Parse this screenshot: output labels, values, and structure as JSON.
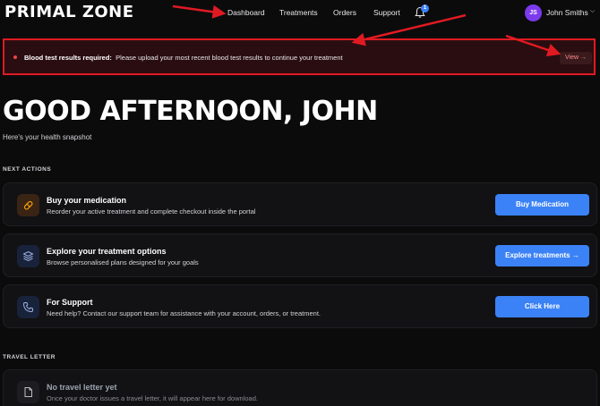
{
  "header": {
    "logo": "PRIMAL ZONE",
    "nav": [
      "Dashboard",
      "Treatments",
      "Orders",
      "Support"
    ],
    "notification_count": "1",
    "user_initials": "JS",
    "user_name": "John Smiths"
  },
  "alert": {
    "title": "Blood test results required:",
    "message": "Please upload your most recent blood test results to continue your treatment",
    "action_label": "View →"
  },
  "greeting": {
    "title": "GOOD AFTERNOON, JOHN",
    "subtitle": "Here's your health snapshot"
  },
  "next_actions": {
    "section_label": "NEXT ACTIONS",
    "cards": [
      {
        "title": "Buy your medication",
        "description": "Reorder your active treatment and complete checkout inside the portal",
        "button": "Buy Medication",
        "icon": "pill-icon"
      },
      {
        "title": "Explore your treatment options",
        "description": "Browse personalised plans designed for your goals",
        "button": "Explore treatments →",
        "icon": "layers-icon"
      },
      {
        "title": "For Support",
        "description": "Need help? Contact our support team for assistance with your account, orders, or treatment.",
        "button": "Click Here",
        "icon": "phone-icon"
      }
    ]
  },
  "travel_letter": {
    "section_label": "TRAVEL LETTER",
    "title": "No travel letter yet",
    "description": "Once your doctor issues a travel letter, it will appear here for download.",
    "icon": "document-icon"
  },
  "colors": {
    "accent": "#3b82f6",
    "alert_border": "#e01a22",
    "annotation_arrow": "#e01a22",
    "avatar": "#7c3aed"
  }
}
